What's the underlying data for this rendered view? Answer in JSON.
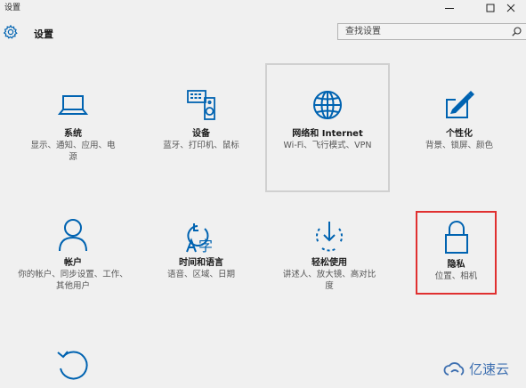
{
  "window": {
    "title": "设置",
    "accent": "#0063b1"
  },
  "header": {
    "title": "设置",
    "search_placeholder": "查找设置"
  },
  "tiles": [
    {
      "name": "系统",
      "desc": "显示、通知、应用、电源",
      "icon": "laptop-icon"
    },
    {
      "name": "设备",
      "desc": "蓝牙、打印机、鼠标",
      "icon": "devices-icon"
    },
    {
      "name": "网络和 Internet",
      "desc": "Wi-Fi、飞行模式、VPN",
      "icon": "globe-icon"
    },
    {
      "name": "个性化",
      "desc": "背景、锁屏、颜色",
      "icon": "paint-icon"
    },
    {
      "name": "帐户",
      "desc": "你的帐户、同步设置、工作、其他用户",
      "icon": "person-icon"
    },
    {
      "name": "时间和语言",
      "desc": "语音、区域、日期",
      "icon": "time-language-icon"
    },
    {
      "name": "轻松使用",
      "desc": "讲述人、放大镜、高对比度",
      "icon": "ease-of-access-icon"
    },
    {
      "name": "隐私",
      "desc": "位置、相机",
      "icon": "lock-icon"
    },
    {
      "name": "",
      "desc": "",
      "icon": "update-icon"
    }
  ],
  "watermark": {
    "text": "亿速云"
  }
}
